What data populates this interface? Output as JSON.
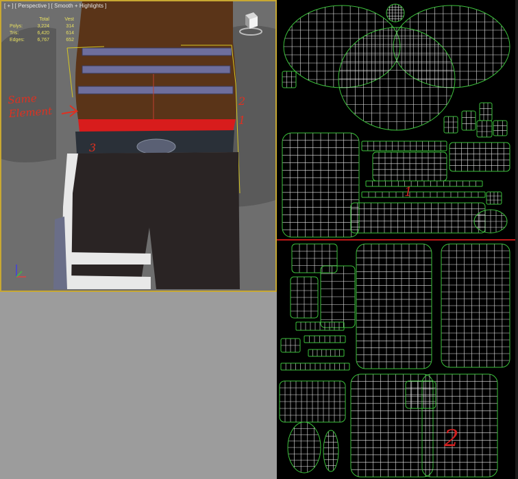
{
  "viewport": {
    "label": "[ + ] [ Perspective ] [ Smooth + Highlights ]",
    "stats": {
      "headers": [
        "",
        "Total",
        "Vest"
      ],
      "rows": [
        {
          "name": "Polys:",
          "total": "3,224",
          "vest": "314"
        },
        {
          "name": "Tris:",
          "total": "6,420",
          "vest": "614"
        },
        {
          "name": "Edges:",
          "total": "6,767",
          "vest": "652"
        }
      ]
    },
    "annotations": {
      "same_line1": "Same",
      "same_line2": "Element",
      "num_1": "1",
      "num_2": "2",
      "num_3": "3"
    }
  },
  "uv_editor": {
    "labels": {
      "section_1": "1",
      "section_2": "2"
    },
    "colors": {
      "wire": "#e8e8e8",
      "border": "#3cc43c",
      "divider": "#c01818"
    }
  },
  "colors": {
    "viewport_bg": "#6e6e6e",
    "skin": "#5a3418",
    "vest_strap": "#6e6e9c",
    "red_selection": "#d81c1c",
    "pants": "#2a2424",
    "annotation_red": "#e03020"
  }
}
